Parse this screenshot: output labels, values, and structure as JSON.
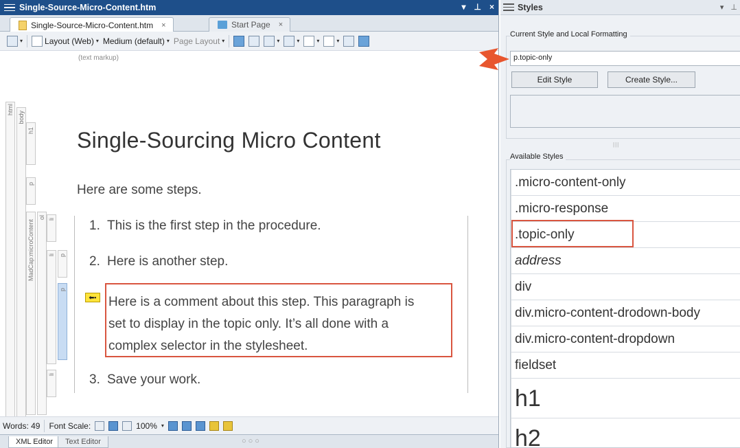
{
  "editor": {
    "title": "Single-Source-Micro-Content.htm",
    "tabs": [
      {
        "label": "Single-Source-Micro-Content.htm",
        "close": "×"
      },
      {
        "label": "Start Page",
        "close": "×"
      }
    ],
    "toolbar": {
      "layout": "Layout (Web)",
      "medium": "Medium (default)",
      "page_layout": "Page Layout"
    },
    "text_markup": "(text markup)",
    "structure_labels": {
      "html": "html",
      "body": "body",
      "h1": "h1",
      "p1": "p",
      "madcap": "MadCap:microContent",
      "ol": "ol",
      "li1": "li",
      "p2": "p",
      "li2": "li",
      "p3": "p",
      "li3": "li",
      "p4": "p",
      "li4": "li"
    },
    "heading": "Single-Sourcing Micro Content",
    "intro": "Here are some steps.",
    "steps": [
      {
        "num": "1.",
        "text": "This is the first step in the procedure."
      },
      {
        "num": "2.",
        "text": "Here is another step."
      },
      {
        "num": "3.",
        "text": "Save your work."
      }
    ],
    "comment_lines": [
      "Here is a comment about this step. This paragraph is",
      "set to display in the topic only. It’s all done with a",
      "complex selector in the stylesheet."
    ],
    "status": {
      "words": "Words: 49",
      "font_scale": "Font Scale:",
      "zoom": "100%"
    },
    "bottom_tabs": [
      "XML Editor",
      "Text Editor"
    ]
  },
  "styles": {
    "title": "Styles",
    "current_label": "Current Style and Local Formatting",
    "current_value": "p.topic-only",
    "edit_button": "Edit Style",
    "create_button": "Create Style...",
    "available_label": "Available Styles",
    "items": [
      {
        "label": ".micro-content-only",
        "italic": false
      },
      {
        "label": ".micro-response",
        "italic": false
      },
      {
        "label": ".topic-only",
        "italic": false
      },
      {
        "label": "address",
        "italic": true
      },
      {
        "label": "div",
        "italic": false
      },
      {
        "label": "div.micro-content-drodown-body",
        "italic": false
      },
      {
        "label": "div.micro-content-dropdown",
        "italic": false
      },
      {
        "label": "fieldset",
        "italic": false
      },
      {
        "label": "h1",
        "italic": false
      },
      {
        "label": "h2",
        "italic": false
      }
    ]
  },
  "colors": {
    "title_bar": "#1e4f8a",
    "highlight": "#d9553f",
    "arrow": "#e8562e"
  }
}
